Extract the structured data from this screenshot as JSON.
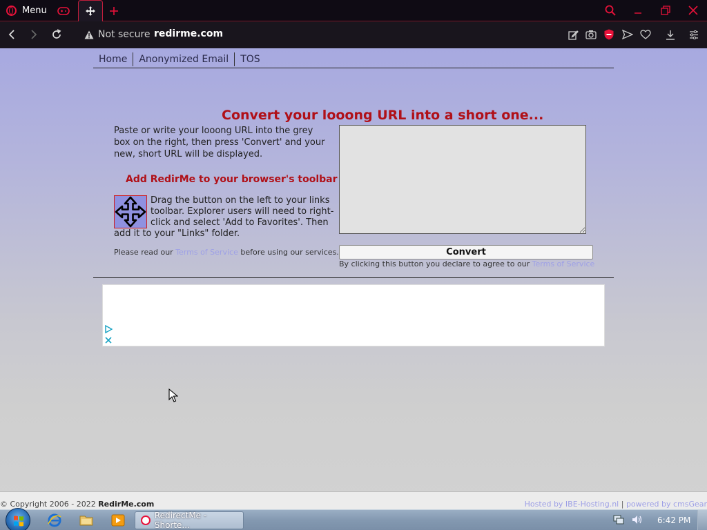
{
  "browser": {
    "menu_label": "Menu",
    "security_text": "Not secure",
    "url": "redirme.com"
  },
  "page": {
    "nav": [
      "Home",
      "Anonymized Email",
      "TOS"
    ],
    "headline": "Convert your looong URL into a short one...",
    "intro": "Paste or write your looong URL into the grey box on the right, then press 'Convert' and your new, short URL will be displayed.",
    "toolbar_heading": "Add RedirMe to your browser's toolbar",
    "drag_text": "Drag the button on the left to your links toolbar. Explorer users will need to right-click and select 'Add to Favorites'. Then add it to your \"Links\" folder.",
    "read_note_before": "Please read our ",
    "read_note_link": "Terms of Service",
    "read_note_after": " before using our services.",
    "url_box_value": "",
    "convert_label": "Convert",
    "declare_before": "By clicking this button you declare to agree to our ",
    "declare_link": "Terms of Service",
    "footer": {
      "copyright": "© Copyright 2006 - 2022 ",
      "site": "RedirMe.com",
      "hosted": "Hosted by IBE-Hosting.nl",
      "separator": "|",
      "powered": "powered by cmsGear"
    }
  },
  "taskbar": {
    "opera_task": "RedirectMe - Shorte...",
    "clock": "6:42 PM"
  },
  "colors": {
    "accent_red": "#b01018",
    "link_blue": "#9ea0e6",
    "opera_red": "#e8123a"
  }
}
